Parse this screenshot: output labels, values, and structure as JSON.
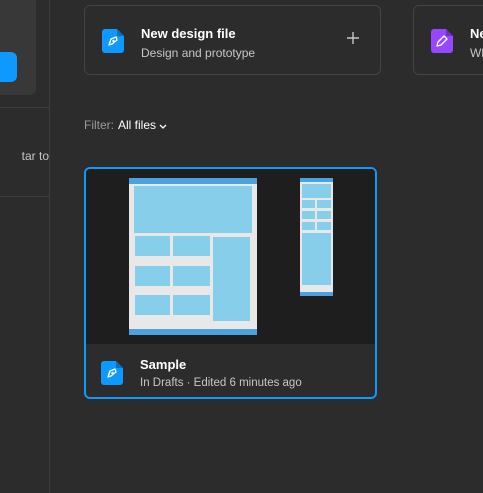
{
  "sidebar": {
    "partial_text": "tar to"
  },
  "new_files": [
    {
      "title": "New design file",
      "subtitle": "Design and prototype",
      "icon": "design-file-icon",
      "color": "#0d99ff"
    },
    {
      "title": "Ne",
      "subtitle": "Wh",
      "icon": "whiteboard-file-icon",
      "color": "#9747ff"
    }
  ],
  "filter": {
    "label": "Filter:",
    "value": "All files"
  },
  "files": [
    {
      "title": "Sample",
      "meta": "In Drafts · Edited 6 minutes ago",
      "icon": "design-file-icon"
    }
  ],
  "colors": {
    "accent": "#0d99ff",
    "background": "#2c2c2c",
    "thumbnail_bg": "#1e1e1e",
    "frame_blue": "#87ceeb"
  }
}
